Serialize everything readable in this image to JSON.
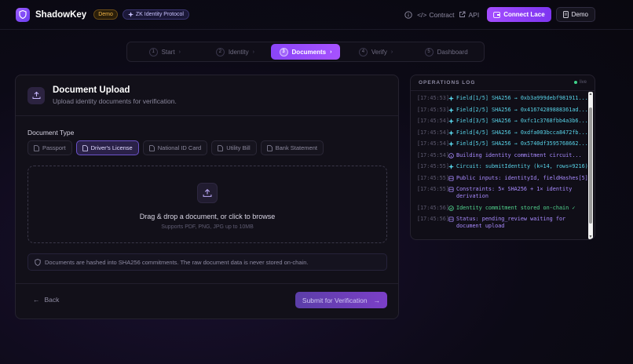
{
  "header": {
    "brand": "ShadowKey",
    "badge_demo": "Demo",
    "badge_protocol": "ZK Identity Protocol",
    "link_contract": "Contract",
    "link_api": "API",
    "connect_label": "Connect Lace",
    "demo_label": "Demo"
  },
  "stepper": {
    "steps": [
      {
        "num": "1",
        "label": "Start"
      },
      {
        "num": "2",
        "label": "Identity"
      },
      {
        "num": "3",
        "label": "Documents"
      },
      {
        "num": "4",
        "label": "Verify"
      },
      {
        "num": "5",
        "label": "Dashboard"
      }
    ],
    "active_index": 2
  },
  "upload": {
    "title": "Document Upload",
    "subtitle": "Upload identity documents for verification.",
    "doc_type_label": "Document Type",
    "doc_types": [
      "Passport",
      "Driver's License",
      "National ID Card",
      "Utility Bill",
      "Bank Statement"
    ],
    "selected_doc_type": "Driver's License",
    "dropzone_title": "Drag & drop a document, or click to browse",
    "dropzone_sub": "Supports PDF, PNG, JPG up to 10MB",
    "info_text": "Documents are hashed into SHA256 commitments. The raw document data is never stored on-chain.",
    "back_label": "Back",
    "submit_label": "Submit for Verification"
  },
  "ops_log": {
    "title": "OPERATIONS LOG",
    "live_label": "live",
    "entries": [
      {
        "ts": "[17:45:53]",
        "kind": "hash",
        "msg": "Field[1/5] SHA256 → 0xb3a999debf981911..."
      },
      {
        "ts": "[17:45:53]",
        "kind": "hash",
        "msg": "Field[2/5] SHA256 → 0x41674289888361ad..."
      },
      {
        "ts": "[17:45:54]",
        "kind": "hash",
        "msg": "Field[3/5] SHA256 → 0xfc1c3768fbb4a3b6..."
      },
      {
        "ts": "[17:45:54]",
        "kind": "hash",
        "msg": "Field[4/5] SHA256 → 0xdfa003bcca8472fb..."
      },
      {
        "ts": "[17:45:54]",
        "kind": "hash",
        "msg": "Field[5/5] SHA256 → 0x5740df3595768662..."
      },
      {
        "ts": "[17:45:54]",
        "kind": "info",
        "msg": "Building identity commitment circuit..."
      },
      {
        "ts": "[17:45:55]",
        "kind": "circuit",
        "msg": "Circuit: submitIdentity (k=14, rows=9216)"
      },
      {
        "ts": "[17:45:55]",
        "kind": "data",
        "msg": "Public inputs: identityId, fieldHashes[5]"
      },
      {
        "ts": "[17:45:55]",
        "kind": "data",
        "msg": "Constraints: 5× SHA256 + 1× identity\nderivation"
      },
      {
        "ts": "[17:45:56]",
        "kind": "success",
        "msg": "Identity commitment stored on-chain ✓"
      },
      {
        "ts": "[17:45:56]",
        "kind": "data",
        "msg": "Status: pending_review waiting for\ndocument upload"
      }
    ]
  },
  "colors": {
    "accent": "#9b4dff",
    "log_hash": "#58d3e8",
    "log_info": "#a98bff",
    "log_success": "#52d68f"
  }
}
